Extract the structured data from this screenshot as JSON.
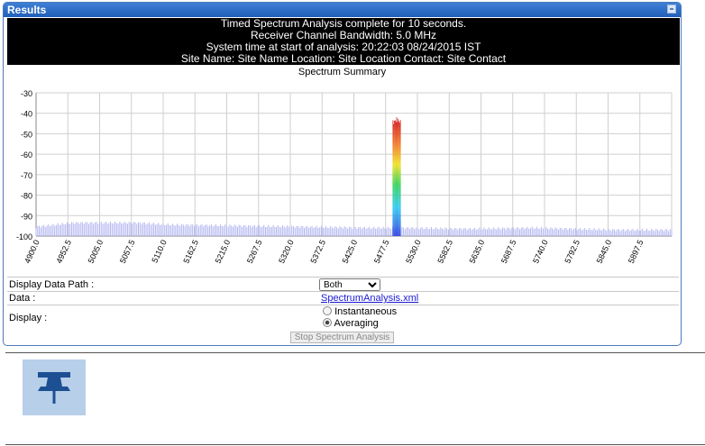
{
  "panel": {
    "title": "Results"
  },
  "info": {
    "lines": [
      "Timed Spectrum Analysis complete for 10 seconds.",
      "Receiver Channel Bandwidth: 5.0 MHz",
      "System time at start of analysis: 20:22:03 08/24/2015 IST",
      "Site Name: Site Name  Location: Site Location  Contact: Site Contact"
    ]
  },
  "chart_data": {
    "type": "bar",
    "title": "Spectrum Summary",
    "xlabel": "",
    "ylabel": "",
    "ylim": [
      -100,
      -30
    ],
    "yticks": [
      "-30",
      "-40",
      "-50",
      "-60",
      "-70",
      "-80",
      "-90",
      "-100"
    ],
    "xlim": [
      4900,
      5925
    ],
    "xticks": [
      "4900.0",
      "4952.5",
      "5005.0",
      "5057.5",
      "5110.0",
      "5162.5",
      "5215.0",
      "5267.5",
      "5320.0",
      "5372.5",
      "5425.0",
      "5477.5",
      "5530.0",
      "5582.5",
      "5635.0",
      "5687.5",
      "5740.0",
      "5792.5",
      "5845.0",
      "5897.5"
    ],
    "grid": true,
    "noise_floor": [
      {
        "x": 4900,
        "y": -95.5
      },
      {
        "x": 4960,
        "y": -93.5
      },
      {
        "x": 5060,
        "y": -93.5
      },
      {
        "x": 5120,
        "y": -94.5
      },
      {
        "x": 5230,
        "y": -95.0
      },
      {
        "x": 5340,
        "y": -95.5
      },
      {
        "x": 5440,
        "y": -96.0
      },
      {
        "x": 5490,
        "y": -96.0
      },
      {
        "x": 5600,
        "y": -96.5
      },
      {
        "x": 5700,
        "y": -96.0
      },
      {
        "x": 5840,
        "y": -97.0
      },
      {
        "x": 5925,
        "y": -97.0
      }
    ],
    "peak": {
      "x_start": 5475,
      "x_end": 5488,
      "y_max": -43
    }
  },
  "controls": {
    "display_data_path": {
      "label": "Display Data Path :",
      "selected": "Both"
    },
    "data": {
      "label": "Data :",
      "link": "SpectrumAnalysis.xml"
    },
    "display": {
      "label": "Display :",
      "options": [
        "Instantaneous",
        "Averaging"
      ],
      "selected": "Averaging"
    },
    "stop_button": "Stop Spectrum Analysis"
  },
  "colors": {
    "header": "#2a6cc8",
    "bars": "#b4b8f0",
    "grid": "#cfcfcf"
  },
  "note": {
    "icon": "pin-icon"
  }
}
